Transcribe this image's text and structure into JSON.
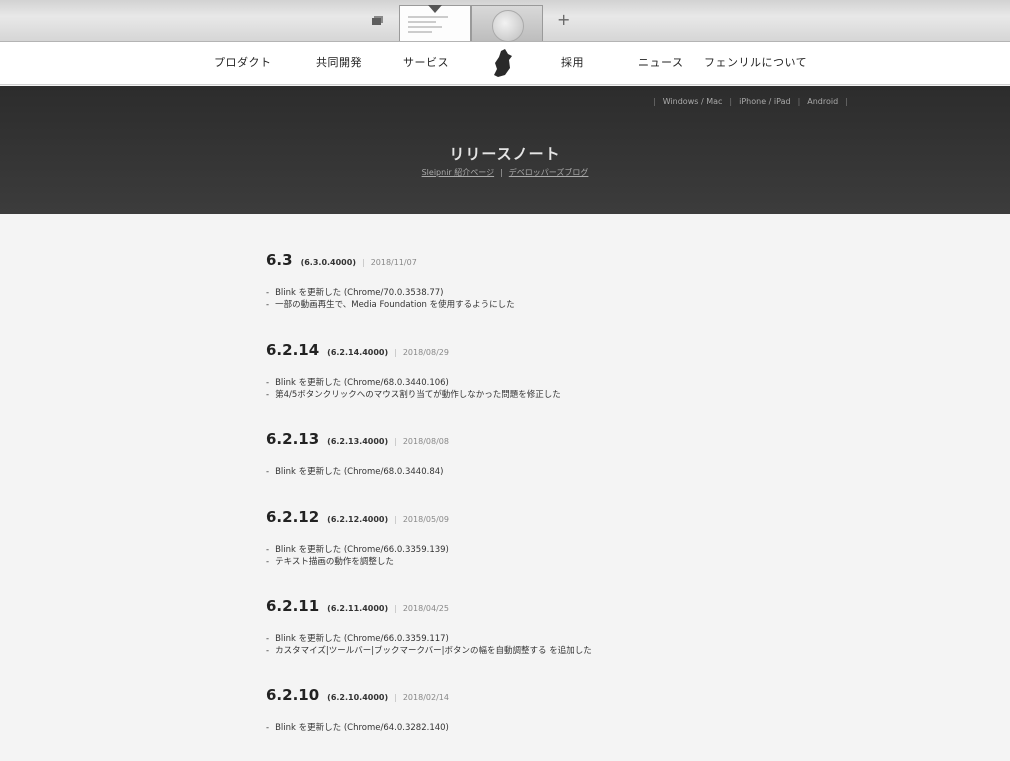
{
  "browser": {
    "tabs_icon": "tabs-overview-icon",
    "new_tab_label": "+"
  },
  "nav": {
    "items": [
      "プロダクト",
      "共同開発",
      "サービス",
      "採用",
      "ニュース",
      "フェンリルについて"
    ],
    "logo": "fenrir-logo-icon"
  },
  "hero": {
    "platforms": [
      "Windows / Mac",
      "iPhone / iPad",
      "Android"
    ],
    "title": "リリースノート",
    "links": [
      "Sleipnir 紹介ページ",
      "デベロッパーズブログ"
    ],
    "link_separator": "|"
  },
  "releases": [
    {
      "version": "6.3",
      "build": "(6.3.0.4000)",
      "date": "2018/11/07",
      "notes": [
        "Blink を更新した (Chrome/70.0.3538.77)",
        "一部の動画再生で、Media Foundation を使用するようにした"
      ]
    },
    {
      "version": "6.2.14",
      "build": "(6.2.14.4000)",
      "date": "2018/08/29",
      "notes": [
        "Blink を更新した (Chrome/68.0.3440.106)",
        "第4/5ボタンクリックへのマウス割り当てが動作しなかった問題を修正した"
      ]
    },
    {
      "version": "6.2.13",
      "build": "(6.2.13.4000)",
      "date": "2018/08/08",
      "notes": [
        "Blink を更新した (Chrome/68.0.3440.84)"
      ]
    },
    {
      "version": "6.2.12",
      "build": "(6.2.12.4000)",
      "date": "2018/05/09",
      "notes": [
        "Blink を更新した (Chrome/66.0.3359.139)",
        "テキスト描画の動作を調整した"
      ]
    },
    {
      "version": "6.2.11",
      "build": "(6.2.11.4000)",
      "date": "2018/04/25",
      "notes": [
        "Blink を更新した (Chrome/66.0.3359.117)",
        "カスタマイズ|ツールバー|ブックマークバー|ボタンの幅を自動調整する を追加した"
      ]
    },
    {
      "version": "6.2.10",
      "build": "(6.2.10.4000)",
      "date": "2018/02/14",
      "notes": [
        "Blink を更新した (Chrome/64.0.3282.140)"
      ]
    }
  ],
  "colors": {
    "hero_bg": "#333333",
    "page_bg": "#f4f4f4",
    "nav_bg": "#ffffff"
  }
}
